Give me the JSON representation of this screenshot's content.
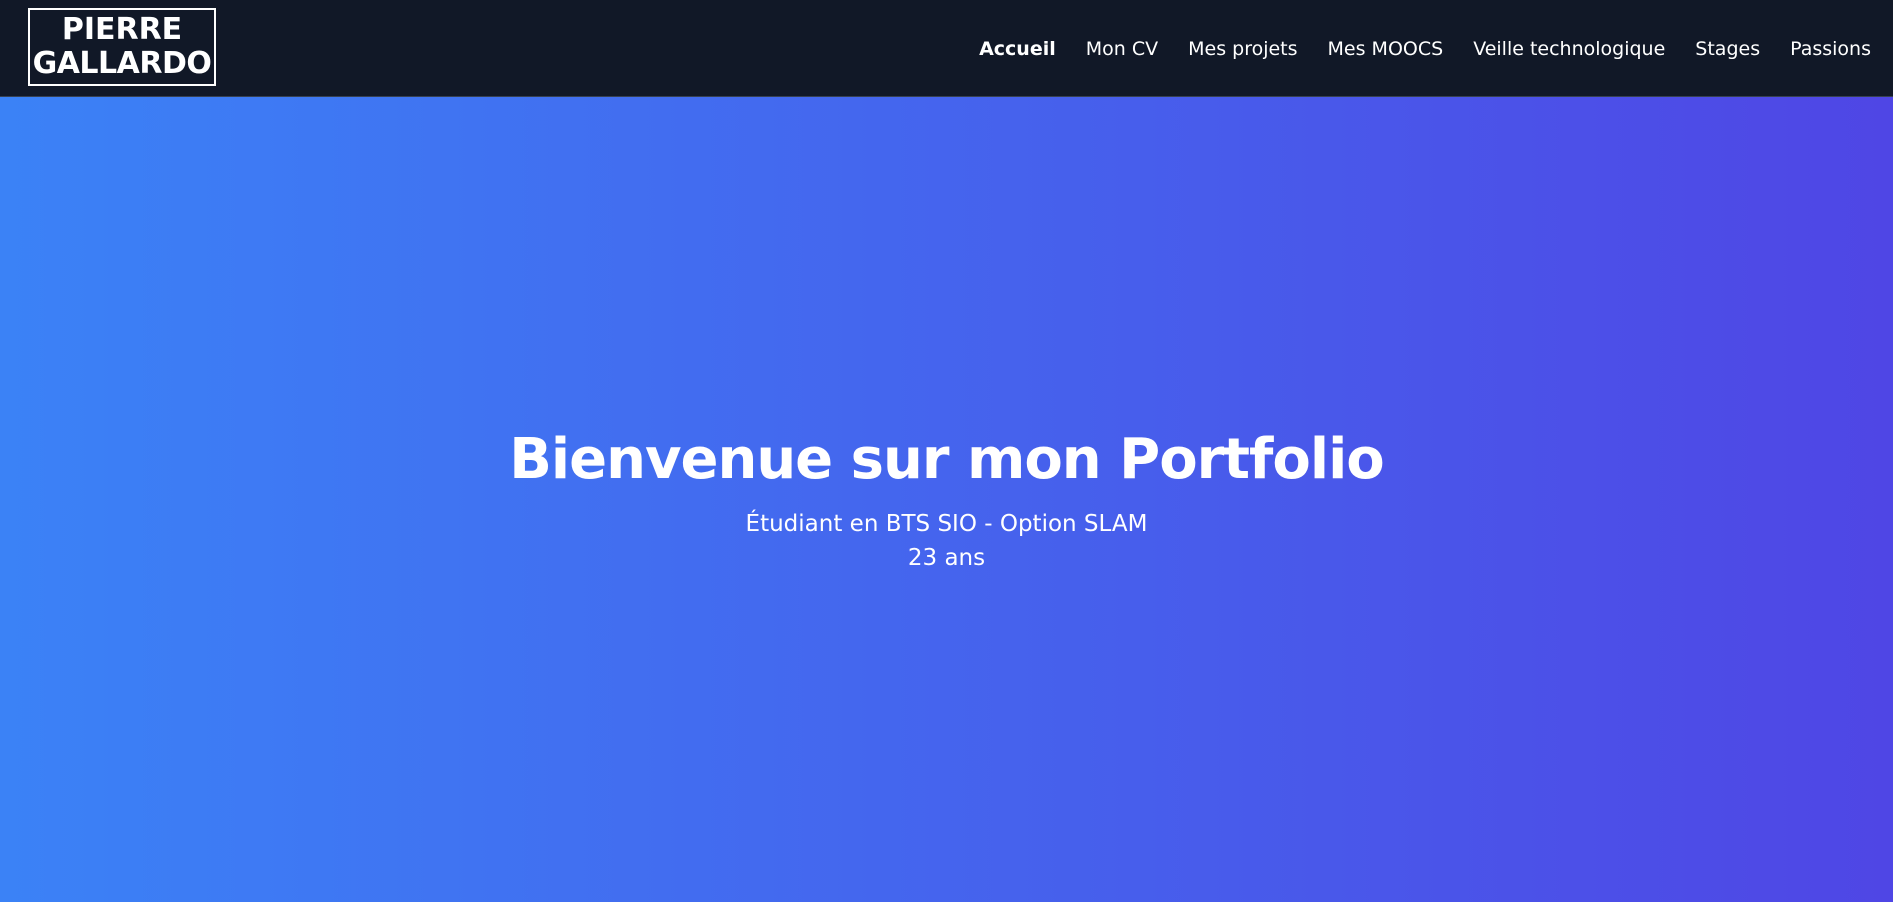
{
  "logo": {
    "line1": "PIERRE",
    "line2": "GALLARDO"
  },
  "nav": {
    "items": [
      {
        "label": "Accueil",
        "active": true
      },
      {
        "label": "Mon CV",
        "active": false
      },
      {
        "label": "Mes projets",
        "active": false
      },
      {
        "label": "Mes MOOCS",
        "active": false
      },
      {
        "label": "Veille technologique",
        "active": false
      },
      {
        "label": "Stages",
        "active": false
      },
      {
        "label": "Passions",
        "active": false
      }
    ]
  },
  "hero": {
    "title": "Bienvenue sur mon Portfolio",
    "subtitle": "Étudiant en BTS SIO - Option SLAM",
    "age": "23 ans"
  },
  "colors": {
    "navbar_bg": "#111827",
    "hero_gradient_start": "#3b82f6",
    "hero_gradient_end": "#4f46e5",
    "text": "#ffffff"
  }
}
